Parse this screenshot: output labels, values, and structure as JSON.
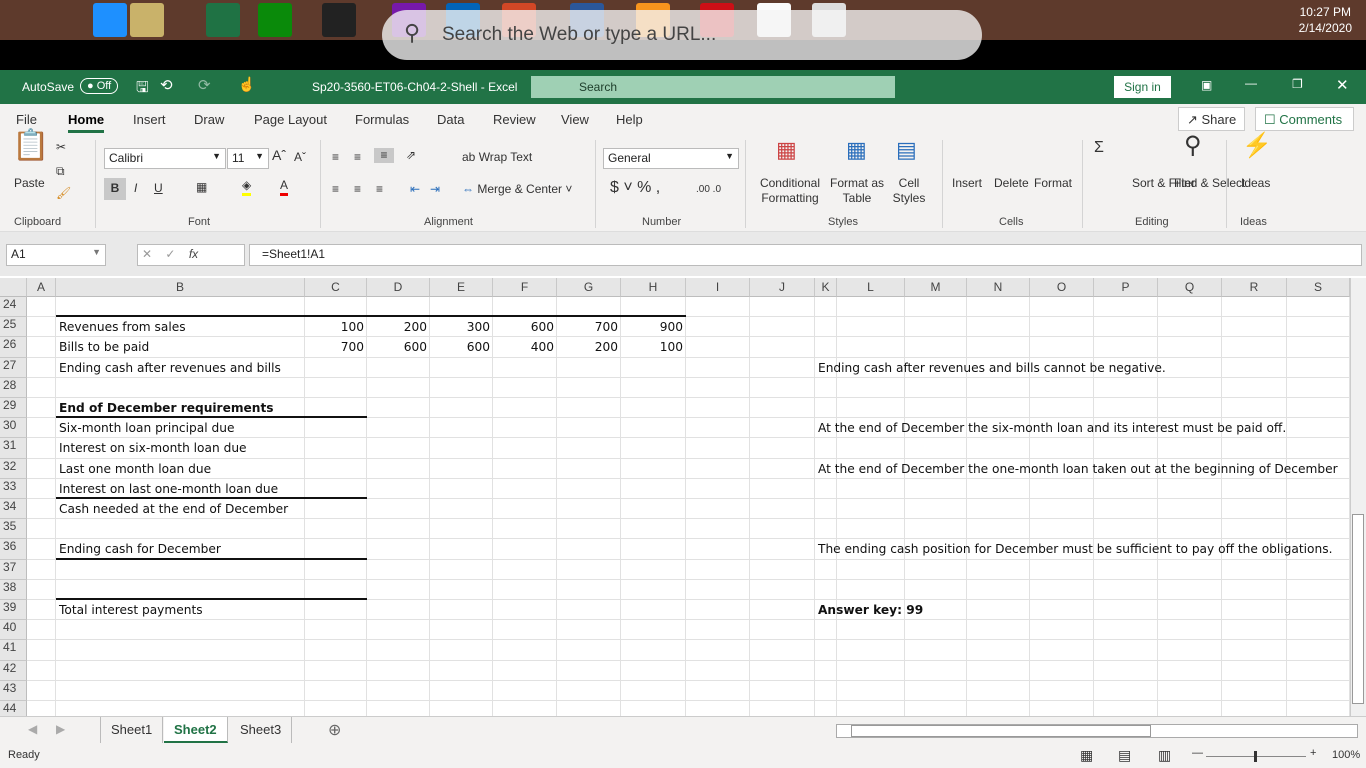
{
  "taskbar": {
    "icons": [
      "windows-start",
      "edge",
      "file-explorer",
      "excel",
      "store",
      "media-player",
      "onenote",
      "outlook",
      "powerpoint",
      "word",
      "settings-app",
      "opera",
      "blank-file",
      "chrome"
    ],
    "search_placeholder": "Search the Web or type a URL...",
    "time": "10:27 PM",
    "date": "2/14/2020"
  },
  "titlebar": {
    "autosave": "AutoSave",
    "autosave_state": "Off",
    "filename": "Sp20-3560-ET06-Ch04-2-Shell  -  Excel",
    "search": "Search",
    "signin": "Sign in"
  },
  "ribbon_tabs": [
    "File",
    "Home",
    "Insert",
    "Draw",
    "Page Layout",
    "Formulas",
    "Data",
    "Review",
    "View",
    "Help"
  ],
  "share": "Share",
  "comments": "Comments",
  "ribbon": {
    "paste": "Paste",
    "font_name": "Calibri",
    "font_size": "11",
    "wrap_text": "Wrap Text",
    "merge_center": "Merge & Center",
    "number_format": "General",
    "conditional": "Conditional Formatting",
    "format_table": "Format as Table",
    "cell_styles": "Cell Styles",
    "insert": "Insert",
    "delete": "Delete",
    "format": "Format",
    "sort_filter": "Sort & Filter",
    "find_select": "Find & Select",
    "ideas": "Ideas",
    "groups": [
      "Clipboard",
      "Font",
      "Alignment",
      "Number",
      "Styles",
      "Cells",
      "Editing",
      "Ideas"
    ]
  },
  "formula_bar": {
    "name_box": "A1",
    "fx": "fx",
    "formula": "=Sheet1!A1"
  },
  "columns": [
    "A",
    "B",
    "C",
    "D",
    "E",
    "F",
    "G",
    "H",
    "I",
    "J",
    "K",
    "L",
    "M",
    "N",
    "O",
    "P",
    "Q",
    "R",
    "S"
  ],
  "rows": [
    24,
    25,
    26,
    27,
    28,
    29,
    30,
    31,
    32,
    33,
    34,
    35,
    36,
    37,
    38,
    39,
    40,
    41,
    42,
    43,
    44
  ],
  "cells": [
    {
      "row": 25,
      "col": "B",
      "text": "Revenues from sales"
    },
    {
      "row": 25,
      "col": "C",
      "text": "100",
      "num": true
    },
    {
      "row": 25,
      "col": "D",
      "text": "200",
      "num": true
    },
    {
      "row": 25,
      "col": "E",
      "text": "300",
      "num": true
    },
    {
      "row": 25,
      "col": "F",
      "text": "600",
      "num": true
    },
    {
      "row": 25,
      "col": "G",
      "text": "700",
      "num": true
    },
    {
      "row": 25,
      "col": "H",
      "text": "900",
      "num": true
    },
    {
      "row": 26,
      "col": "B",
      "text": "Bills to be paid"
    },
    {
      "row": 26,
      "col": "C",
      "text": "700",
      "num": true
    },
    {
      "row": 26,
      "col": "D",
      "text": "600",
      "num": true
    },
    {
      "row": 26,
      "col": "E",
      "text": "600",
      "num": true
    },
    {
      "row": 26,
      "col": "F",
      "text": "400",
      "num": true
    },
    {
      "row": 26,
      "col": "G",
      "text": "200",
      "num": true
    },
    {
      "row": 26,
      "col": "H",
      "text": "100",
      "num": true
    },
    {
      "row": 27,
      "col": "B",
      "text": "Ending cash after revenues and bills"
    },
    {
      "row": 27,
      "col": "K",
      "text": "Ending cash after revenues and bills cannot be negative."
    },
    {
      "row": 29,
      "col": "B",
      "text": "End of December requirements",
      "bold": true
    },
    {
      "row": 30,
      "col": "B",
      "text": "Six-month loan principal due"
    },
    {
      "row": 30,
      "col": "K",
      "text": "At the end of December the six-month loan and its interest must be paid off."
    },
    {
      "row": 31,
      "col": "B",
      "text": "Interest on six-month loan due"
    },
    {
      "row": 32,
      "col": "B",
      "text": "Last one month loan due"
    },
    {
      "row": 32,
      "col": "K",
      "text": "At the end of December the one-month loan taken out at the beginning of December"
    },
    {
      "row": 33,
      "col": "B",
      "text": "Interest on last one-month loan due"
    },
    {
      "row": 34,
      "col": "B",
      "text": "Cash needed at the end of December"
    },
    {
      "row": 36,
      "col": "B",
      "text": "Ending cash for December"
    },
    {
      "row": 36,
      "col": "K",
      "text": "The ending cash position for December must be sufficient to pay off the obligations."
    },
    {
      "row": 39,
      "col": "B",
      "text": "Total interest payments"
    },
    {
      "row": 39,
      "col": "K",
      "text": "Answer key: 99",
      "bold": true
    }
  ],
  "sheet_tabs": [
    "Sheet1",
    "Sheet2",
    "Sheet3"
  ],
  "active_sheet": "Sheet2",
  "status": {
    "text": "Ready",
    "zoom": "100%"
  }
}
